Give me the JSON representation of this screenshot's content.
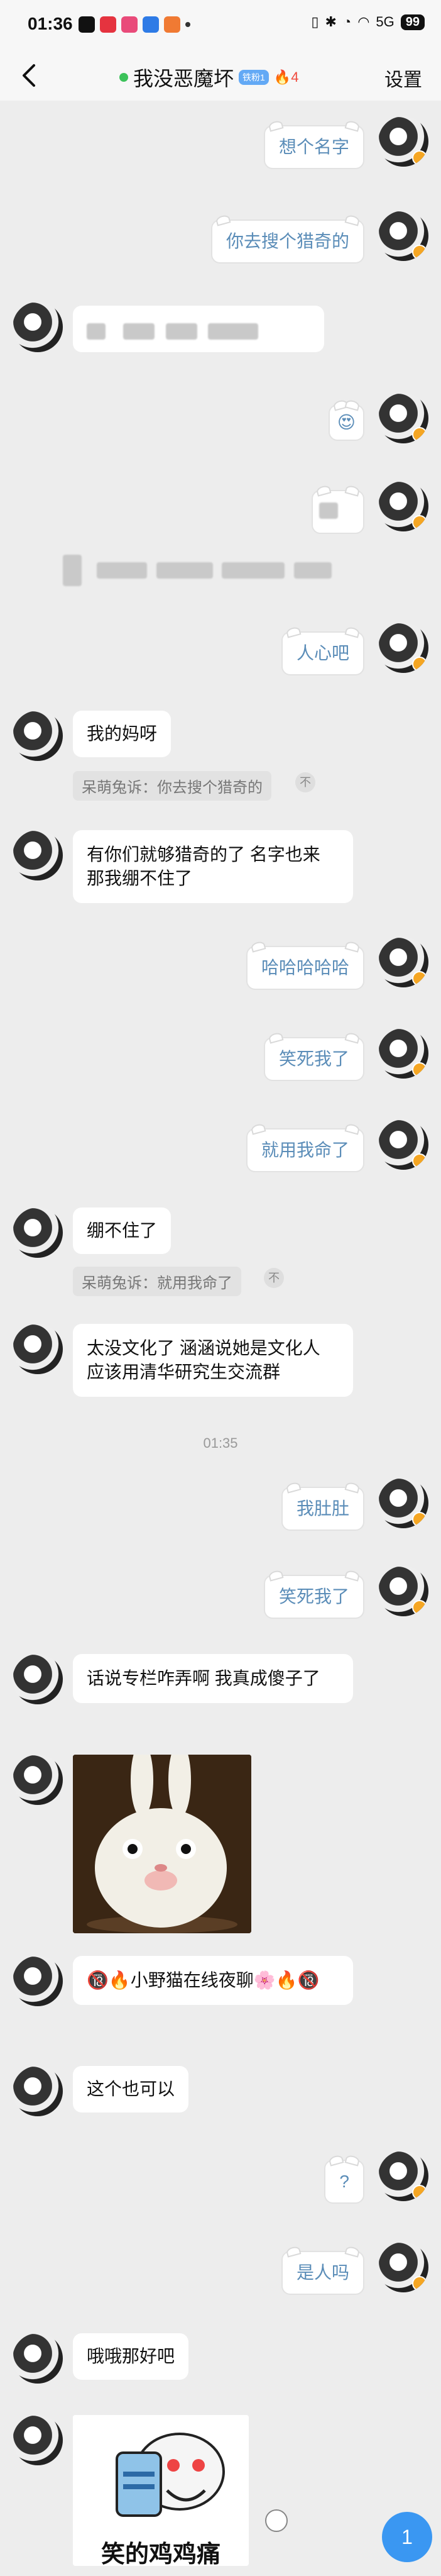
{
  "status_bar": {
    "time": "01:36",
    "battery": "99",
    "network": "5G"
  },
  "header": {
    "title": "我没恶魔坏",
    "level_badge": "铁粉1",
    "fire_count": "4",
    "settings_label": "设置"
  },
  "messages": [
    {
      "id": 0,
      "side": "me",
      "text": "想个名字"
    },
    {
      "id": 1,
      "side": "me",
      "text": "你去搜个猎奇的"
    },
    {
      "id": 2,
      "side": "them",
      "type": "redacted"
    },
    {
      "id": 3,
      "side": "me",
      "type": "emoji",
      "text": "😍"
    },
    {
      "id": 4,
      "side": "me",
      "type": "redacted"
    },
    {
      "id": 5,
      "side": "them",
      "type": "redacted-wide"
    },
    {
      "id": 6,
      "side": "me",
      "text": "人心吧"
    },
    {
      "id": 7,
      "side": "them",
      "text": "我的妈呀",
      "quote": "呆萌兔诉：你去搜个猎奇的",
      "quote_x": "不"
    },
    {
      "id": 8,
      "side": "them",
      "text": "有你们就够猎奇的了 名字也来 那我绷不住了"
    },
    {
      "id": 9,
      "side": "me",
      "text": "哈哈哈哈哈"
    },
    {
      "id": 10,
      "side": "me",
      "text": "笑死我了"
    },
    {
      "id": 11,
      "side": "me",
      "text": "就用我命了"
    },
    {
      "id": 12,
      "side": "them",
      "text": "绷不住了",
      "quote": "呆萌兔诉：就用我命了",
      "quote_x": "不"
    },
    {
      "id": 13,
      "side": "them",
      "text": "太没文化了 涵涵说她是文化人 应该用清华研究生交流群"
    },
    {
      "id": 14,
      "side": "me",
      "text": "我肚肚"
    },
    {
      "id": 15,
      "side": "me",
      "text": "笑死我了"
    },
    {
      "id": 16,
      "side": "them",
      "text": "话说专栏咋弄啊 我真成傻子了"
    },
    {
      "id": 17,
      "side": "them",
      "type": "sticker-rabbit"
    },
    {
      "id": 18,
      "side": "them",
      "text": "🔞🔥小野猫在线夜聊🌸🔥🔞"
    },
    {
      "id": 19,
      "side": "them",
      "text": "这个也可以"
    },
    {
      "id": 20,
      "side": "me",
      "text": "?"
    },
    {
      "id": 21,
      "side": "me",
      "text": "是人吗"
    },
    {
      "id": 22,
      "side": "them",
      "text": "哦哦那好吧"
    },
    {
      "id": 23,
      "side": "them",
      "type": "sticker-laugh",
      "caption": "笑的鸡鸡痛"
    }
  ],
  "timestamp": "01:35",
  "unread_badge": "1",
  "colors": {
    "accent_blue": "#3A97F2",
    "online": "#3CC25A",
    "me_text": "#5B8DB8"
  }
}
